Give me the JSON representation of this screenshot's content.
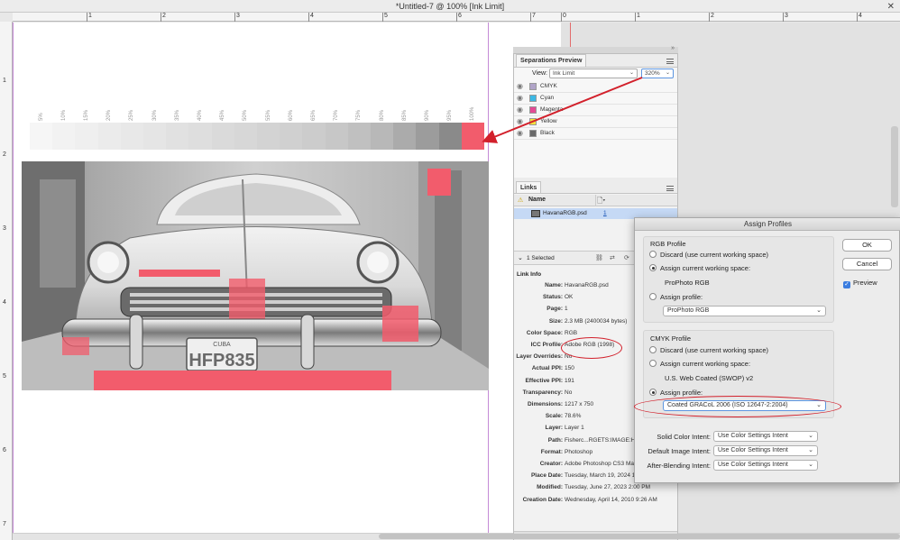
{
  "window": {
    "title": "*Untitled-7 @ 100% [Ink Limit]",
    "close_glyph": "✕"
  },
  "rulers": {
    "h_numbers": [
      "1",
      "2",
      "3",
      "4",
      "5",
      "6",
      "7",
      "0",
      "1",
      "2",
      "3",
      "4"
    ],
    "v_numbers": [
      "1",
      "2",
      "3",
      "4",
      "5",
      "6",
      "7"
    ]
  },
  "ink_swatches": {
    "labels": [
      "5%",
      "10%",
      "15%",
      "20%",
      "25%",
      "30%",
      "35%",
      "40%",
      "45%",
      "50%",
      "55%",
      "60%",
      "65%",
      "70%",
      "75%",
      "80%",
      "85%",
      "90%",
      "95%",
      "100%"
    ],
    "colors": [
      "#f6f6f6",
      "#f2f2f2",
      "#efefef",
      "#ebebeb",
      "#e8e8e8",
      "#e5e5e5",
      "#e1e1e1",
      "#dedede",
      "#dadada",
      "#d7d7d7",
      "#d3d3d3",
      "#d0d0d0",
      "#cccccc",
      "#c7c7c7",
      "#c0c0c0",
      "#b8b8b8",
      "#ababab",
      "#9c9c9c",
      "#8a8a8a",
      "#f25c6c"
    ]
  },
  "photo": {
    "plate_top": "CUBA",
    "plate_number": "HFP835"
  },
  "separations_preview": {
    "tab_label": "Separations Preview",
    "view_label": "View:",
    "view_value": "Ink Limit",
    "ink_limit_value": "320%",
    "items": [
      {
        "label": "CMYK",
        "color": "#b0a4c8"
      },
      {
        "label": "Cyan",
        "color": "#3cb8e4"
      },
      {
        "label": "Magenta",
        "color": "#e44b94"
      },
      {
        "label": "Yellow",
        "color": "#f4e23c"
      },
      {
        "label": "Black",
        "color": "#6a6a6a"
      }
    ]
  },
  "links_panel": {
    "tab_label": "Links",
    "column_name": "Name",
    "row_name": "HavanaRGB.psd",
    "row_page": "1",
    "selected_count": "1 Selected",
    "link_info_title": "Link Info",
    "info": [
      {
        "key": "Name:",
        "value": "HavanaRGB.psd"
      },
      {
        "key": "Status:",
        "value": "OK"
      },
      {
        "key": "Page:",
        "value": "1"
      },
      {
        "key": "Size:",
        "value": "2.3 MB (2400034 bytes)"
      },
      {
        "key": "Color Space:",
        "value": "RGB"
      },
      {
        "key": "ICC Profile:",
        "value": "Adobe RGB (1998)"
      },
      {
        "key": "Layer Overrides:",
        "value": "No"
      },
      {
        "key": "Actual PPI:",
        "value": "150"
      },
      {
        "key": "Effective PPI:",
        "value": "191"
      },
      {
        "key": "Transparency:",
        "value": "No"
      },
      {
        "key": "Dimensions:",
        "value": "1217 x 750"
      },
      {
        "key": "Scale:",
        "value": "78.6%"
      },
      {
        "key": "Layer:",
        "value": "Layer 1"
      },
      {
        "key": "Path:",
        "value": "Fisherc...RGETS:IMAGE:Hav"
      },
      {
        "key": "Format:",
        "value": "Photoshop"
      },
      {
        "key": "Creator:",
        "value": "Adobe Photoshop CS3 Mac"
      },
      {
        "key": "Place Date:",
        "value": "Tuesday, March 19, 2024 1"
      },
      {
        "key": "Modified:",
        "value": "Tuesday, June 27, 2023 2:00 PM"
      },
      {
        "key": "Creation Date:",
        "value": "Wednesday, April 14, 2010 9:26 AM"
      }
    ]
  },
  "assign_profiles": {
    "title": "Assign Profiles",
    "rgb": {
      "title": "RGB Profile",
      "discard": "Discard (use current working space)",
      "assign_current": "Assign current working space:",
      "current_profile": "ProPhoto RGB",
      "assign_profile": "Assign profile:",
      "profile_select": "ProPhoto RGB"
    },
    "cmyk": {
      "title": "CMYK Profile",
      "discard": "Discard (use current working space)",
      "assign_current": "Assign current working space:",
      "current_profile": "U.S. Web Coated (SWOP) v2",
      "assign_profile": "Assign profile:",
      "profile_select": "Coated GRACoL 2006 (ISO 12647-2:2004)"
    },
    "intents": [
      {
        "label": "Solid Color Intent:",
        "value": "Use Color Settings Intent"
      },
      {
        "label": "Default Image Intent:",
        "value": "Use Color Settings Intent"
      },
      {
        "label": "After-Blending Intent:",
        "value": "Use Color Settings Intent"
      }
    ],
    "ok_label": "OK",
    "cancel_label": "Cancel",
    "preview_label": "Preview"
  },
  "colors": {
    "callout_red": "#d2202b",
    "ink_over_limit": "#f25c6c",
    "guide_purple": "#c58bd6"
  }
}
